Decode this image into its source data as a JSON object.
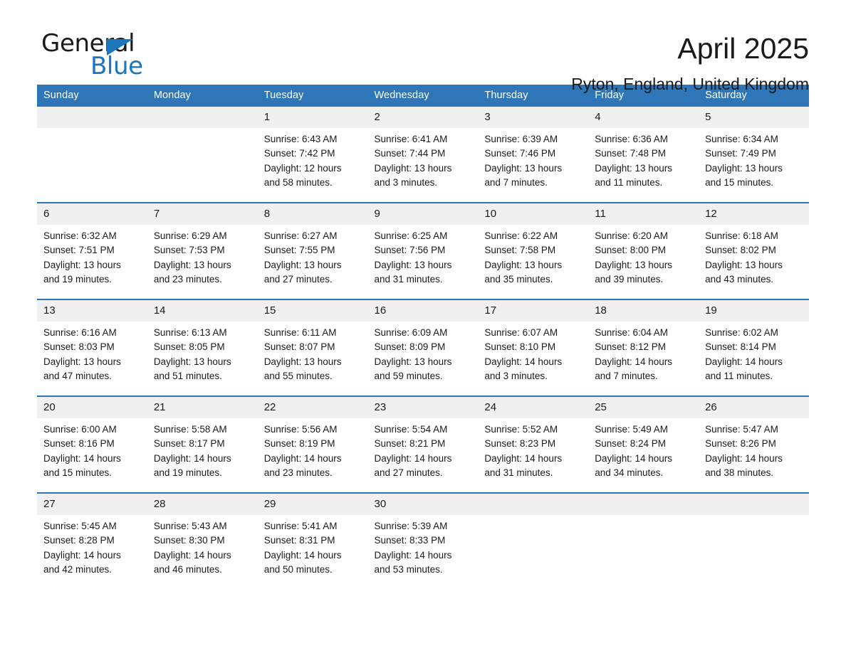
{
  "brand": {
    "line1": "General",
    "line2": "Blue",
    "triangle_color": "#1b76bc"
  },
  "header": {
    "title": "April 2025",
    "subtitle": "Ryton, England, United Kingdom"
  },
  "colors": {
    "header_blue": "#2e76b8",
    "daynum_band": "#f0f0f0",
    "text": "#1a1a1a"
  },
  "weekday_headers": [
    "Sunday",
    "Monday",
    "Tuesday",
    "Wednesday",
    "Thursday",
    "Friday",
    "Saturday"
  ],
  "weeks": [
    [
      {
        "day": "",
        "sunrise": "",
        "sunset": "",
        "daylight_a": "",
        "daylight_b": ""
      },
      {
        "day": "",
        "sunrise": "",
        "sunset": "",
        "daylight_a": "",
        "daylight_b": ""
      },
      {
        "day": "1",
        "sunrise": "Sunrise: 6:43 AM",
        "sunset": "Sunset: 7:42 PM",
        "daylight_a": "Daylight: 12 hours",
        "daylight_b": "and 58 minutes."
      },
      {
        "day": "2",
        "sunrise": "Sunrise: 6:41 AM",
        "sunset": "Sunset: 7:44 PM",
        "daylight_a": "Daylight: 13 hours",
        "daylight_b": "and 3 minutes."
      },
      {
        "day": "3",
        "sunrise": "Sunrise: 6:39 AM",
        "sunset": "Sunset: 7:46 PM",
        "daylight_a": "Daylight: 13 hours",
        "daylight_b": "and 7 minutes."
      },
      {
        "day": "4",
        "sunrise": "Sunrise: 6:36 AM",
        "sunset": "Sunset: 7:48 PM",
        "daylight_a": "Daylight: 13 hours",
        "daylight_b": "and 11 minutes."
      },
      {
        "day": "5",
        "sunrise": "Sunrise: 6:34 AM",
        "sunset": "Sunset: 7:49 PM",
        "daylight_a": "Daylight: 13 hours",
        "daylight_b": "and 15 minutes."
      }
    ],
    [
      {
        "day": "6",
        "sunrise": "Sunrise: 6:32 AM",
        "sunset": "Sunset: 7:51 PM",
        "daylight_a": "Daylight: 13 hours",
        "daylight_b": "and 19 minutes."
      },
      {
        "day": "7",
        "sunrise": "Sunrise: 6:29 AM",
        "sunset": "Sunset: 7:53 PM",
        "daylight_a": "Daylight: 13 hours",
        "daylight_b": "and 23 minutes."
      },
      {
        "day": "8",
        "sunrise": "Sunrise: 6:27 AM",
        "sunset": "Sunset: 7:55 PM",
        "daylight_a": "Daylight: 13 hours",
        "daylight_b": "and 27 minutes."
      },
      {
        "day": "9",
        "sunrise": "Sunrise: 6:25 AM",
        "sunset": "Sunset: 7:56 PM",
        "daylight_a": "Daylight: 13 hours",
        "daylight_b": "and 31 minutes."
      },
      {
        "day": "10",
        "sunrise": "Sunrise: 6:22 AM",
        "sunset": "Sunset: 7:58 PM",
        "daylight_a": "Daylight: 13 hours",
        "daylight_b": "and 35 minutes."
      },
      {
        "day": "11",
        "sunrise": "Sunrise: 6:20 AM",
        "sunset": "Sunset: 8:00 PM",
        "daylight_a": "Daylight: 13 hours",
        "daylight_b": "and 39 minutes."
      },
      {
        "day": "12",
        "sunrise": "Sunrise: 6:18 AM",
        "sunset": "Sunset: 8:02 PM",
        "daylight_a": "Daylight: 13 hours",
        "daylight_b": "and 43 minutes."
      }
    ],
    [
      {
        "day": "13",
        "sunrise": "Sunrise: 6:16 AM",
        "sunset": "Sunset: 8:03 PM",
        "daylight_a": "Daylight: 13 hours",
        "daylight_b": "and 47 minutes."
      },
      {
        "day": "14",
        "sunrise": "Sunrise: 6:13 AM",
        "sunset": "Sunset: 8:05 PM",
        "daylight_a": "Daylight: 13 hours",
        "daylight_b": "and 51 minutes."
      },
      {
        "day": "15",
        "sunrise": "Sunrise: 6:11 AM",
        "sunset": "Sunset: 8:07 PM",
        "daylight_a": "Daylight: 13 hours",
        "daylight_b": "and 55 minutes."
      },
      {
        "day": "16",
        "sunrise": "Sunrise: 6:09 AM",
        "sunset": "Sunset: 8:09 PM",
        "daylight_a": "Daylight: 13 hours",
        "daylight_b": "and 59 minutes."
      },
      {
        "day": "17",
        "sunrise": "Sunrise: 6:07 AM",
        "sunset": "Sunset: 8:10 PM",
        "daylight_a": "Daylight: 14 hours",
        "daylight_b": "and 3 minutes."
      },
      {
        "day": "18",
        "sunrise": "Sunrise: 6:04 AM",
        "sunset": "Sunset: 8:12 PM",
        "daylight_a": "Daylight: 14 hours",
        "daylight_b": "and 7 minutes."
      },
      {
        "day": "19",
        "sunrise": "Sunrise: 6:02 AM",
        "sunset": "Sunset: 8:14 PM",
        "daylight_a": "Daylight: 14 hours",
        "daylight_b": "and 11 minutes."
      }
    ],
    [
      {
        "day": "20",
        "sunrise": "Sunrise: 6:00 AM",
        "sunset": "Sunset: 8:16 PM",
        "daylight_a": "Daylight: 14 hours",
        "daylight_b": "and 15 minutes."
      },
      {
        "day": "21",
        "sunrise": "Sunrise: 5:58 AM",
        "sunset": "Sunset: 8:17 PM",
        "daylight_a": "Daylight: 14 hours",
        "daylight_b": "and 19 minutes."
      },
      {
        "day": "22",
        "sunrise": "Sunrise: 5:56 AM",
        "sunset": "Sunset: 8:19 PM",
        "daylight_a": "Daylight: 14 hours",
        "daylight_b": "and 23 minutes."
      },
      {
        "day": "23",
        "sunrise": "Sunrise: 5:54 AM",
        "sunset": "Sunset: 8:21 PM",
        "daylight_a": "Daylight: 14 hours",
        "daylight_b": "and 27 minutes."
      },
      {
        "day": "24",
        "sunrise": "Sunrise: 5:52 AM",
        "sunset": "Sunset: 8:23 PM",
        "daylight_a": "Daylight: 14 hours",
        "daylight_b": "and 31 minutes."
      },
      {
        "day": "25",
        "sunrise": "Sunrise: 5:49 AM",
        "sunset": "Sunset: 8:24 PM",
        "daylight_a": "Daylight: 14 hours",
        "daylight_b": "and 34 minutes."
      },
      {
        "day": "26",
        "sunrise": "Sunrise: 5:47 AM",
        "sunset": "Sunset: 8:26 PM",
        "daylight_a": "Daylight: 14 hours",
        "daylight_b": "and 38 minutes."
      }
    ],
    [
      {
        "day": "27",
        "sunrise": "Sunrise: 5:45 AM",
        "sunset": "Sunset: 8:28 PM",
        "daylight_a": "Daylight: 14 hours",
        "daylight_b": "and 42 minutes."
      },
      {
        "day": "28",
        "sunrise": "Sunrise: 5:43 AM",
        "sunset": "Sunset: 8:30 PM",
        "daylight_a": "Daylight: 14 hours",
        "daylight_b": "and 46 minutes."
      },
      {
        "day": "29",
        "sunrise": "Sunrise: 5:41 AM",
        "sunset": "Sunset: 8:31 PM",
        "daylight_a": "Daylight: 14 hours",
        "daylight_b": "and 50 minutes."
      },
      {
        "day": "30",
        "sunrise": "Sunrise: 5:39 AM",
        "sunset": "Sunset: 8:33 PM",
        "daylight_a": "Daylight: 14 hours",
        "daylight_b": "and 53 minutes."
      },
      {
        "day": "",
        "sunrise": "",
        "sunset": "",
        "daylight_a": "",
        "daylight_b": ""
      },
      {
        "day": "",
        "sunrise": "",
        "sunset": "",
        "daylight_a": "",
        "daylight_b": ""
      },
      {
        "day": "",
        "sunrise": "",
        "sunset": "",
        "daylight_a": "",
        "daylight_b": ""
      }
    ]
  ]
}
